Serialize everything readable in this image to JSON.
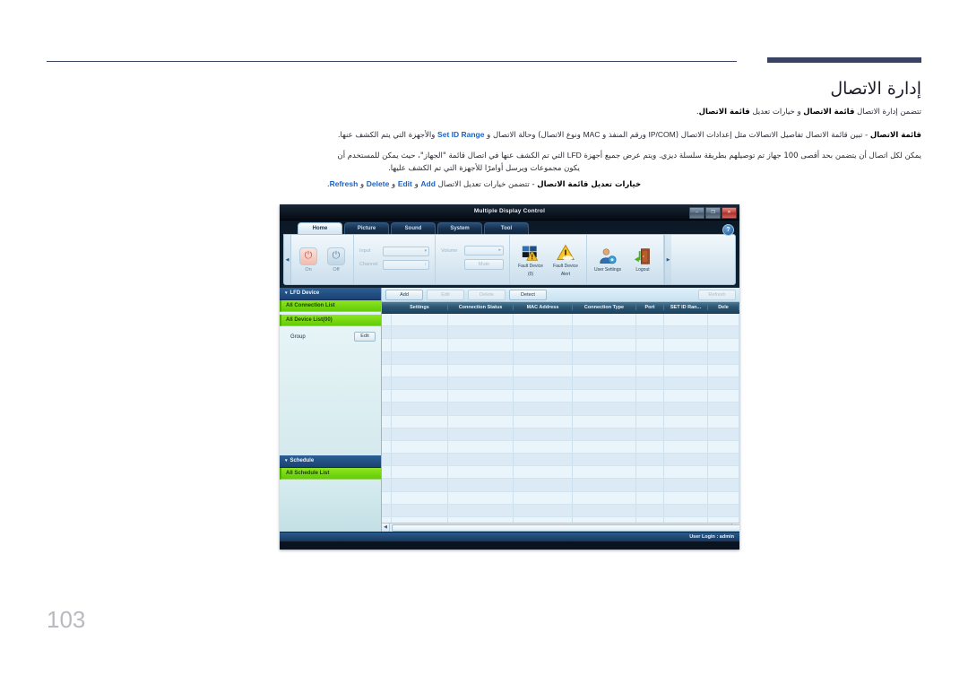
{
  "document": {
    "title": "إدارة الاتصال",
    "page_number": "103",
    "paragraphs": {
      "p1_prefix": "تتضمن إدارة الاتصال ",
      "p1_bold1": "قائمة الاتصال",
      "p1_mid": " و خيارات تعديل ",
      "p1_bold2": "قائمة الاتصال",
      "p1_suffix": ".",
      "p2_bold": "قائمة الاتصال",
      "p2_a": " - تبين قائمة الاتصال تفاصيل الاتصالات مثل إعدادات الاتصال (",
      "p2_lat1": "IP/COM",
      "p2_b": " ورقم المنفذ و ",
      "p2_lat2": "MAC",
      "p2_c": " ونوع الاتصال) وحالة الاتصال و ",
      "p2_link": "Set ID Range",
      "p2_d": " والأجهزة التي يتم الكشف عنها.",
      "p3_a": "يمكن لكل اتصال أن يتضمن بحد أقصى 100 جهاز تم توصيلهم بطريقة سلسلة ديزي. ويتم عرض جميع أجهزة ",
      "p3_lat": "LFD",
      "p3_b": " التي تم الكشف عنها في اتصال قائمة \"الجهاز\"، حيث يمكن للمستخدم أن",
      "p3_c": "يكون مجموعات ويرسل أوامرًا للأجهزة التي تم الكشف عليها.",
      "p4_bold": "خيارات تعديل قائمة الاتصال",
      "p4_a": " - تتضمن خيارات تعديل الاتصال ",
      "p4_link1": "Add",
      "p4_b": " و ",
      "p4_link2": "Edit",
      "p4_c": " و ",
      "p4_link3": "Delete",
      "p4_d": " و ",
      "p4_link4": "Refresh",
      "p4_e": "."
    }
  },
  "app": {
    "window_title": "Multiple Display Control",
    "window_buttons": {
      "minimize": "–",
      "maximize": "❐",
      "close": "✕"
    },
    "help_label": "?",
    "tabs": [
      {
        "label": "Home",
        "active": true
      },
      {
        "label": "Picture",
        "active": false
      },
      {
        "label": "Sound",
        "active": false
      },
      {
        "label": "System",
        "active": false
      },
      {
        "label": "Tool",
        "active": false
      }
    ],
    "ribbon": {
      "scroll_left": "◀",
      "scroll_right": "▶",
      "power": {
        "on_label": "On",
        "off_label": "Off",
        "glyph": "⏻"
      },
      "source": {
        "input_label": "Input",
        "input_value": "",
        "channel_label": "Channel",
        "channel_value": "",
        "input_caret": "▾",
        "channel_caret": "↕"
      },
      "audio": {
        "volume_label": "Volume",
        "volume_value": "",
        "volume_caret": "▸",
        "mute_label": "Mute"
      },
      "icons": [
        {
          "name": "fault-device-icon",
          "label_line1": "Fault Device",
          "label_line2": "(0)"
        },
        {
          "name": "fault-device-alert-icon",
          "label_line1": "Fault Device",
          "label_line2": "Alert"
        },
        {
          "name": "user-settings-icon",
          "label_line1": "User Settings",
          "label_line2": ""
        },
        {
          "name": "logout-icon",
          "label_line1": "Logout",
          "label_line2": ""
        }
      ]
    },
    "sidebar": {
      "lfd_device_header": "LFD Device",
      "caret": "▾",
      "all_connection_list": "All Connection List",
      "all_device_list": "All Device List(00)",
      "group_label": "Group",
      "group_edit_button": "Edit",
      "schedule_header": "Schedule",
      "all_schedule_list": "All Schedule List"
    },
    "toolbar": {
      "buttons": [
        {
          "label": "Add",
          "enabled": true
        },
        {
          "label": "Edit",
          "enabled": false
        },
        {
          "label": "Delete",
          "enabled": false
        },
        {
          "label": "Detect",
          "enabled": true
        }
      ],
      "refresh_label": "Refresh",
      "refresh_enabled": false
    },
    "table": {
      "columns": [
        "Settings",
        "Connection Status",
        "MAC Address",
        "Connection Type",
        "Port",
        "SET ID Ran...",
        "Dele"
      ],
      "rows": []
    },
    "scrollbar": {
      "left_arrow": "◀",
      "right_arrow": "▶"
    },
    "statusbar": {
      "text": "User Login : admin"
    }
  },
  "colors": {
    "accent_blue": "#1b64c8",
    "sidebar_green": "#62cc06",
    "title_bar": "#0d1622",
    "rule": "#3c4464"
  }
}
